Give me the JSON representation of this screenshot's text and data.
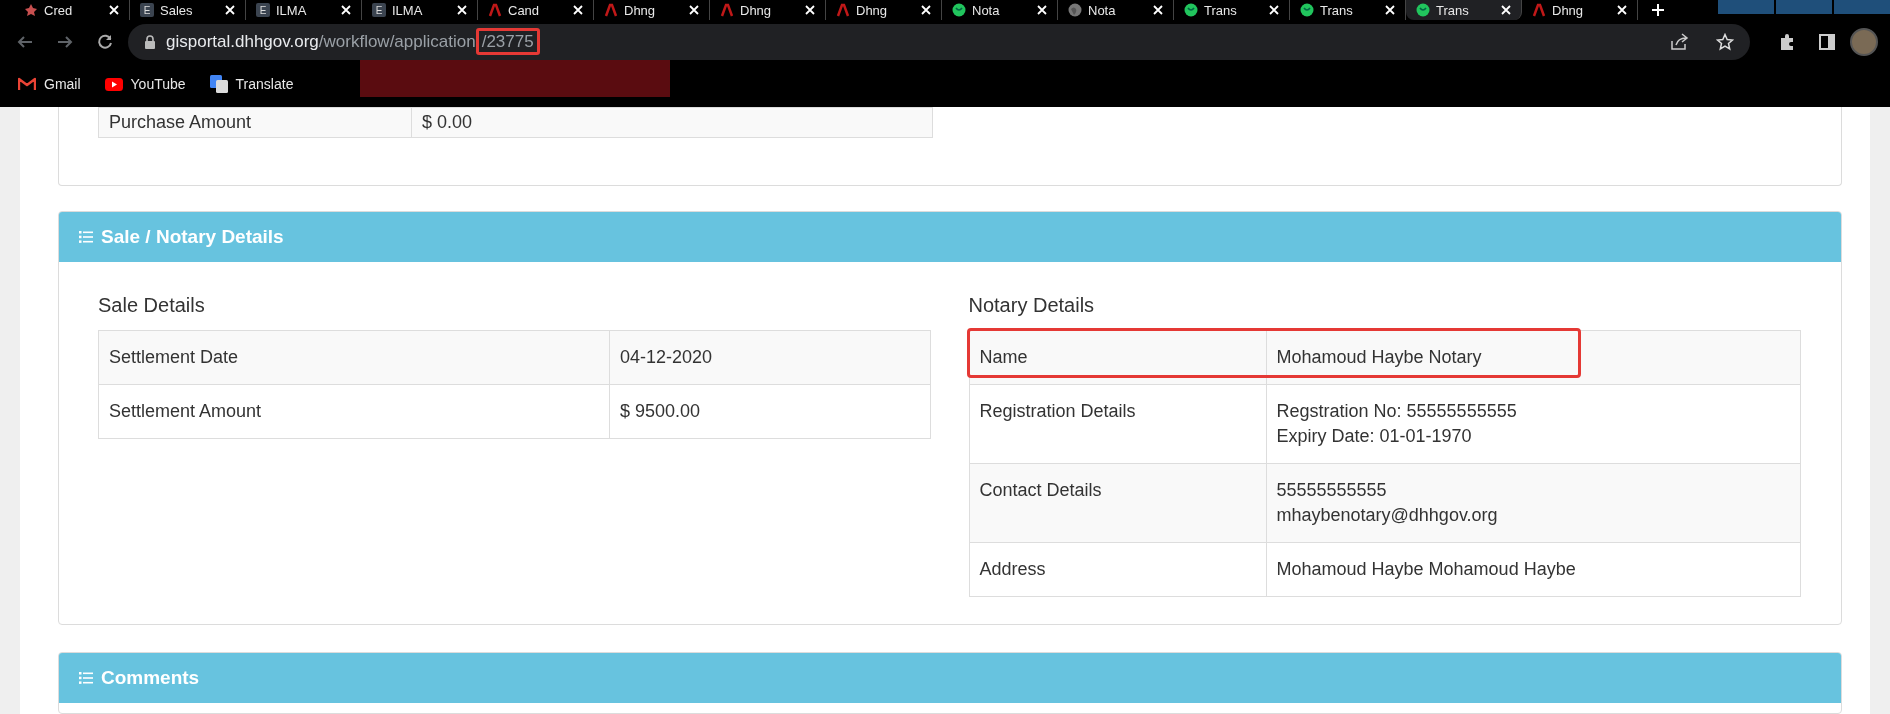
{
  "browser": {
    "tabs": [
      {
        "title": "Cred",
        "kind": "star",
        "selected": false
      },
      {
        "title": "Sales",
        "kind": "letter",
        "badge": "E",
        "selected": false
      },
      {
        "title": "ILMA",
        "kind": "letter",
        "badge": "E",
        "selected": false
      },
      {
        "title": "ILMA",
        "kind": "letter",
        "badge": "E",
        "selected": false
      },
      {
        "title": "Cand",
        "kind": "red",
        "selected": false
      },
      {
        "title": "Dhng",
        "kind": "red",
        "selected": false
      },
      {
        "title": "Dhng",
        "kind": "red",
        "selected": false
      },
      {
        "title": "Dhng",
        "kind": "red",
        "selected": false
      },
      {
        "title": "Nota",
        "kind": "green",
        "selected": false
      },
      {
        "title": "Nota",
        "kind": "globe",
        "selected": false
      },
      {
        "title": "Trans",
        "kind": "green",
        "selected": false
      },
      {
        "title": "Trans",
        "kind": "green",
        "selected": false
      },
      {
        "title": "Trans",
        "kind": "green",
        "selected": true
      },
      {
        "title": "Dhng",
        "kind": "red",
        "selected": false
      }
    ],
    "address": {
      "host": "gisportal.dhhgov.org",
      "path": "/workflow/application",
      "highlighted_part": "/23775"
    },
    "bookmarks": [
      {
        "label": "Gmail",
        "kind": "gmail"
      },
      {
        "label": "YouTube",
        "kind": "youtube"
      },
      {
        "label": "Translate",
        "kind": "translate"
      }
    ]
  },
  "purchase_table": {
    "rows": [
      {
        "label": "Purchase Amount",
        "value": "$ 0.00"
      }
    ]
  },
  "sale_notary_panel": {
    "title": "Sale / Notary Details",
    "sale_details": {
      "heading": "Sale Details",
      "rows": [
        {
          "label": "Settlement Date",
          "lines": [
            "04-12-2020"
          ],
          "highlighted": false
        },
        {
          "label": "Settlement Amount",
          "lines": [
            "$ 9500.00"
          ],
          "highlighted": false
        }
      ]
    },
    "notary_details": {
      "heading": "Notary Details",
      "rows": [
        {
          "label": "Name",
          "lines": [
            "Mohamoud Haybe Notary"
          ],
          "highlighted": true
        },
        {
          "label": "Registration Details",
          "lines": [
            "Regstration No: 55555555555",
            "Expiry Date: 01-01-1970"
          ],
          "highlighted": false
        },
        {
          "label": "Contact Details",
          "lines": [
            "55555555555",
            "mhaybenotary@dhhgov.org"
          ],
          "highlighted": false
        },
        {
          "label": "Address",
          "lines": [
            "Mohamoud Haybe Mohamoud Haybe"
          ],
          "highlighted": false
        }
      ]
    }
  },
  "comments_panel": {
    "title": "Comments"
  }
}
